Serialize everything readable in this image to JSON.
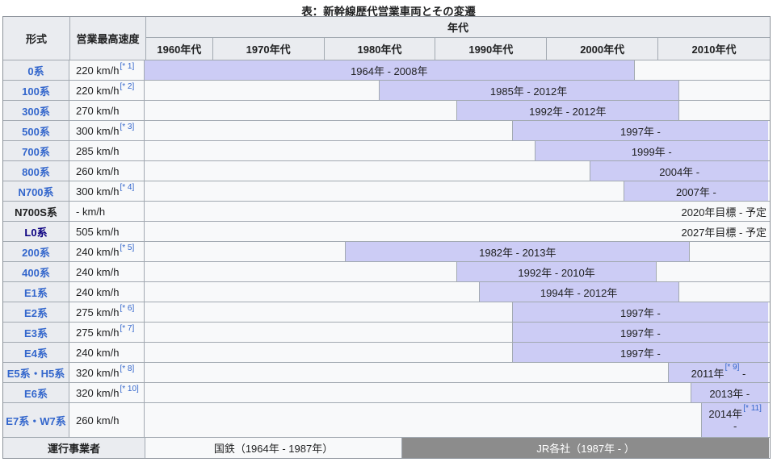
{
  "title": "表：新幹線歴代営業車両とその変遷",
  "header": {
    "model": "形式",
    "speed": "営業最高速度",
    "era": "年代",
    "decades": [
      {
        "label": "1960年代",
        "start": 1964,
        "end": 1970
      },
      {
        "label": "1970年代",
        "start": 1970,
        "end": 1980
      },
      {
        "label": "1980年代",
        "start": 1980,
        "end": 1990
      },
      {
        "label": "1990年代",
        "start": 1990,
        "end": 2000
      },
      {
        "label": "2000年代",
        "start": 2000,
        "end": 2010
      },
      {
        "label": "2010年代",
        "start": 2010,
        "end": 2020
      }
    ]
  },
  "timeline": {
    "start_year": 1964,
    "end_year": 2020
  },
  "rows": [
    {
      "model": "0系",
      "link": "link",
      "speed": "220 km/h",
      "note": "[* 1]",
      "bar": {
        "start": 1964,
        "end": 2008,
        "label": "1964年 - 2008年"
      }
    },
    {
      "model": "100系",
      "link": "link",
      "speed": "220 km/h",
      "note": "[* 2]",
      "bar": {
        "start": 1985,
        "end": 2012,
        "label": "1985年 - 2012年"
      }
    },
    {
      "model": "300系",
      "link": "link",
      "speed": "270 km/h",
      "bar": {
        "start": 1992,
        "end": 2012,
        "label": "1992年 - 2012年"
      }
    },
    {
      "model": "500系",
      "link": "link",
      "speed": "300 km/h",
      "note": "[* 3]",
      "bar": {
        "start": 1997,
        "end": 2020,
        "label": "1997年 -"
      }
    },
    {
      "model": "700系",
      "link": "link",
      "speed": "285 km/h",
      "bar": {
        "start": 1999,
        "end": 2020,
        "label": "1999年 -"
      }
    },
    {
      "model": "800系",
      "link": "link",
      "speed": "260 km/h",
      "bar": {
        "start": 2004,
        "end": 2020,
        "label": "2004年 -"
      }
    },
    {
      "model": "N700系",
      "link": "link",
      "speed": "300 km/h",
      "note": "[* 4]",
      "bar": {
        "start": 2007,
        "end": 2020,
        "label": "2007年 -"
      }
    },
    {
      "model": "N700S系",
      "link": "none",
      "speed": "- km/h",
      "right_text": "2020年目標 - 予定"
    },
    {
      "model": "L0系",
      "link": "visited",
      "speed": "505 km/h",
      "right_text": "2027年目標 - 予定"
    },
    {
      "model": "200系",
      "link": "link",
      "speed": "240 km/h",
      "note": "[* 5]",
      "bar": {
        "start": 1982,
        "end": 2013,
        "label": "1982年 - 2013年"
      }
    },
    {
      "model": "400系",
      "link": "link",
      "speed": "240 km/h",
      "bar": {
        "start": 1992,
        "end": 2010,
        "label": "1992年 - 2010年"
      }
    },
    {
      "model": "E1系",
      "link": "link",
      "speed": "240 km/h",
      "bar": {
        "start": 1994,
        "end": 2012,
        "label": "1994年 - 2012年"
      }
    },
    {
      "model": "E2系",
      "link": "link",
      "speed": "275 km/h",
      "note": "[* 6]",
      "bar": {
        "start": 1997,
        "end": 2020,
        "label": "1997年 -"
      }
    },
    {
      "model": "E3系",
      "link": "link",
      "speed": "275 km/h",
      "note": "[* 7]",
      "bar": {
        "start": 1997,
        "end": 2020,
        "label": "1997年 -"
      }
    },
    {
      "model": "E4系",
      "link": "link",
      "speed": "240 km/h",
      "bar": {
        "start": 1997,
        "end": 2020,
        "label": "1997年 -"
      }
    },
    {
      "model": "E5系・H5系",
      "link": "link",
      "speed": "320 km/h",
      "note": "[* 8]",
      "bar": {
        "start": 2011,
        "end": 2020,
        "label": "2011年",
        "bar_note": "[* 9]",
        "suffix": " -"
      }
    },
    {
      "model": "E6系",
      "link": "link",
      "speed": "320 km/h",
      "note": "[* 10]",
      "bar": {
        "start": 2013,
        "end": 2020,
        "label": "2013年 -"
      }
    },
    {
      "model": "E7系・W7系",
      "link": "link",
      "speed": "260 km/h",
      "tall": true,
      "bar": {
        "start": 2014,
        "end": 2020,
        "label": "2014年",
        "bar_note": "[* 11]",
        "suffix": "-",
        "wrap": true
      }
    }
  ],
  "footer": {
    "label": "運行事業者",
    "segments": [
      {
        "label": "国鉄（1964年 - 1987年）",
        "start": 1964,
        "end": 1987,
        "variant": "light"
      },
      {
        "label": "JR各社（1987年 - ）",
        "start": 1987,
        "end": 2020,
        "variant": "dark"
      }
    ]
  },
  "colors": {
    "bar": "#ccccf5",
    "link": "#3366cc",
    "visited_link": "#0b0080",
    "header_bg": "#eaecf0",
    "cell_bg": "#f8f9fa",
    "border": "#a2a9b1",
    "operator_jr_bg": "#8c8c8c",
    "text": "#202122"
  },
  "chart_data": {
    "type": "table",
    "subtype": "gantt-timeline",
    "title": "表：新幹線歴代営業車両とその変遷",
    "columns": [
      "形式",
      "営業最高速度",
      "年代"
    ],
    "xlabel": "年代",
    "xlim": [
      1964,
      2020
    ],
    "x_ticks": [
      "1960年代",
      "1970年代",
      "1980年代",
      "1990年代",
      "2000年代",
      "2010年代"
    ],
    "series": [
      {
        "name": "0系",
        "speed": "220 km/h[* 1]",
        "start": 1964,
        "end": 2008,
        "period": "1964年 - 2008年"
      },
      {
        "name": "100系",
        "speed": "220 km/h[* 2]",
        "start": 1985,
        "end": 2012,
        "period": "1985年 - 2012年"
      },
      {
        "name": "300系",
        "speed": "270 km/h",
        "start": 1992,
        "end": 2012,
        "period": "1992年 - 2012年"
      },
      {
        "name": "500系",
        "speed": "300 km/h[* 3]",
        "start": 1997,
        "end": null,
        "period": "1997年 -"
      },
      {
        "name": "700系",
        "speed": "285 km/h",
        "start": 1999,
        "end": null,
        "period": "1999年 -"
      },
      {
        "name": "800系",
        "speed": "260 km/h",
        "start": 2004,
        "end": null,
        "period": "2004年 -"
      },
      {
        "name": "N700系",
        "speed": "300 km/h[* 4]",
        "start": 2007,
        "end": null,
        "period": "2007年 -"
      },
      {
        "name": "N700S系",
        "speed": "- km/h",
        "start": null,
        "end": null,
        "period": "2020年目標 - 予定"
      },
      {
        "name": "L0系",
        "speed": "505 km/h",
        "start": null,
        "end": null,
        "period": "2027年目標 - 予定"
      },
      {
        "name": "200系",
        "speed": "240 km/h[* 5]",
        "start": 1982,
        "end": 2013,
        "period": "1982年 - 2013年"
      },
      {
        "name": "400系",
        "speed": "240 km/h",
        "start": 1992,
        "end": 2010,
        "period": "1992年 - 2010年"
      },
      {
        "name": "E1系",
        "speed": "240 km/h",
        "start": 1994,
        "end": 2012,
        "period": "1994年 - 2012年"
      },
      {
        "name": "E2系",
        "speed": "275 km/h[* 6]",
        "start": 1997,
        "end": null,
        "period": "1997年 -"
      },
      {
        "name": "E3系",
        "speed": "275 km/h[* 7]",
        "start": 1997,
        "end": null,
        "period": "1997年 -"
      },
      {
        "name": "E4系",
        "speed": "240 km/h",
        "start": 1997,
        "end": null,
        "period": "1997年 -"
      },
      {
        "name": "E5系・H5系",
        "speed": "320 km/h[* 8]",
        "start": 2011,
        "end": null,
        "period": "2011年[* 9] -"
      },
      {
        "name": "E6系",
        "speed": "320 km/h[* 10]",
        "start": 2013,
        "end": null,
        "period": "2013年 -"
      },
      {
        "name": "E7系・W7系",
        "speed": "260 km/h",
        "start": 2014,
        "end": null,
        "period": "2014年[* 11] -"
      }
    ],
    "operators": [
      {
        "name": "国鉄（1964年 - 1987年）",
        "start": 1964,
        "end": 1987
      },
      {
        "name": "JR各社（1987年 - ）",
        "start": 1987,
        "end": null
      }
    ]
  }
}
